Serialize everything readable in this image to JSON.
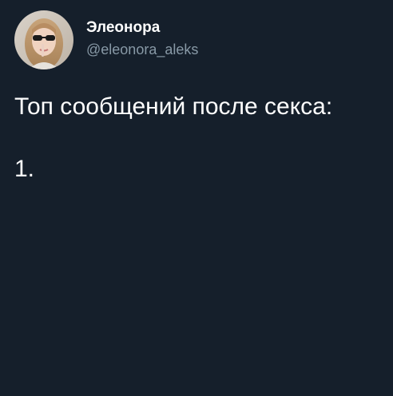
{
  "author": {
    "display_name": "Элеонора",
    "handle": "@eleonora_aleks",
    "avatar_icon": "profile-photo-avatar"
  },
  "tweet": {
    "lines": [
      "Топ сообщений после секса:",
      "1."
    ]
  },
  "colors": {
    "background": "#151f2b",
    "text": "#ffffff",
    "secondary_text": "#8899a6"
  }
}
